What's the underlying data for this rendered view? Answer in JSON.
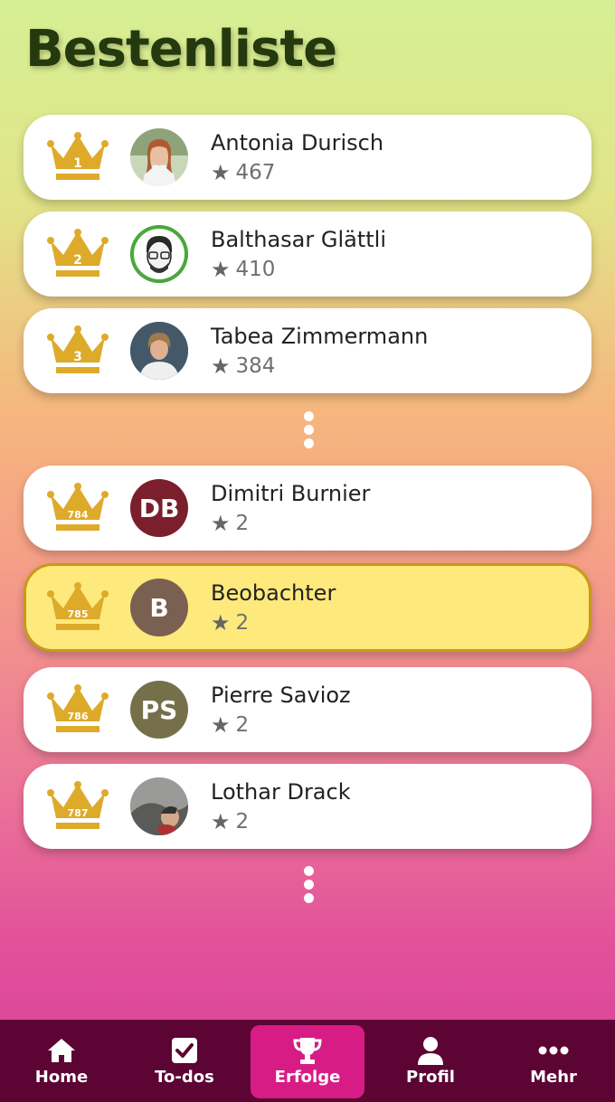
{
  "page": {
    "title": "Bestenliste"
  },
  "top_entries": [
    {
      "rank": "1",
      "name": "Antonia Durisch",
      "score": "467",
      "avatar_type": "photo"
    },
    {
      "rank": "2",
      "name": "Balthasar Glättli",
      "score": "410",
      "avatar_type": "illustration"
    },
    {
      "rank": "3",
      "name": "Tabea Zimmermann",
      "score": "384",
      "avatar_type": "photo"
    }
  ],
  "near_entries": [
    {
      "rank": "784",
      "name": "Dimitri Burnier",
      "score": "2",
      "initials": "DB",
      "avatar_color": "#7a1f2b"
    },
    {
      "rank": "785",
      "name": "Beobachter",
      "score": "2",
      "initials": "B",
      "avatar_color": "#7a6050",
      "is_current_user": true
    },
    {
      "rank": "786",
      "name": "Pierre Savioz",
      "score": "2",
      "initials": "PS",
      "avatar_color": "#76704a"
    },
    {
      "rank": "787",
      "name": "Lothar Drack",
      "score": "2",
      "avatar_type": "photo"
    }
  ],
  "nav": {
    "items": [
      {
        "label": "Home",
        "icon": "home-icon"
      },
      {
        "label": "To-dos",
        "icon": "checkbox-icon"
      },
      {
        "label": "Erfolge",
        "icon": "trophy-icon",
        "active": true
      },
      {
        "label": "Profil",
        "icon": "person-icon"
      },
      {
        "label": "Mehr",
        "icon": "more-icon"
      }
    ]
  },
  "colors": {
    "crown": "#deaa2a",
    "nav_bg": "#5c0433",
    "nav_active": "#d81c86",
    "highlight": "#fde97c"
  }
}
